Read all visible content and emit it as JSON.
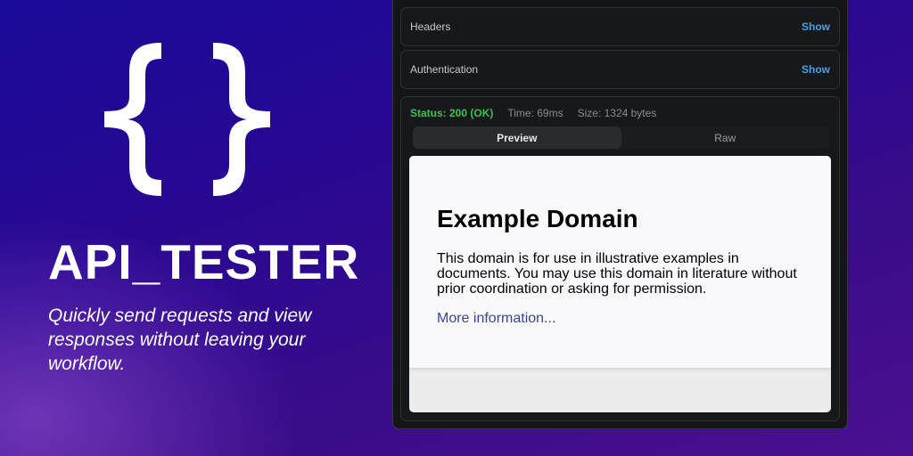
{
  "hero": {
    "title": "API_TESTER",
    "tagline": "Quickly send requests and view responses without leaving your workflow."
  },
  "panel": {
    "headers": {
      "label": "Headers",
      "action": "Show"
    },
    "auth": {
      "label": "Authentication",
      "action": "Show"
    },
    "response": {
      "status": "Status: 200 (OK)",
      "time": "Time: 69ms",
      "size": "Size: 1324 bytes",
      "tabs": [
        {
          "label": "Preview"
        },
        {
          "label": "Raw"
        }
      ],
      "preview": {
        "heading": "Example Domain",
        "body": "This domain is for use in illustrative examples in documents. You may use this domain in literature without prior coordination or asking for permission.",
        "link": "More information..."
      }
    }
  },
  "colors": {
    "status_ok": "#3fbf4f",
    "link": "#4d9fe0"
  }
}
